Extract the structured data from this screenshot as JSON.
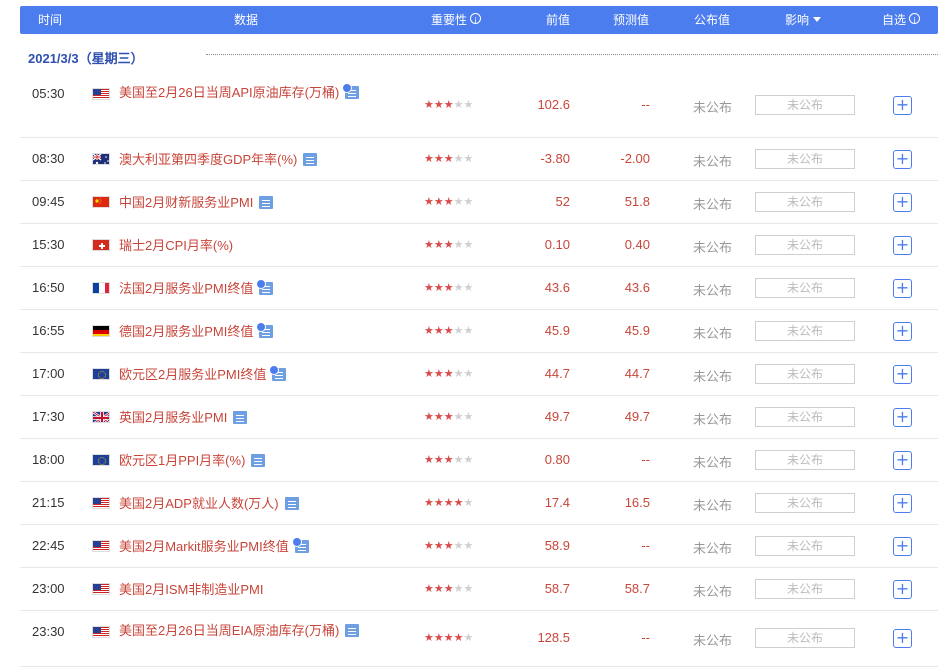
{
  "header": {
    "time": "时间",
    "data": "数据",
    "importance": "重要性",
    "info_glyph": "i",
    "previous": "前值",
    "forecast": "预测值",
    "actual": "公布值",
    "impact": "影响",
    "watchlist": "自选"
  },
  "date_label": "2021/3/3（星期三）",
  "rows": [
    {
      "time": "05:30",
      "flag": "us",
      "name": "美国至2月26日当周API原油库存(万桶)",
      "stars": 3,
      "prev": "102.6",
      "forecast": "--",
      "actual": "未公布",
      "impact": "未公布",
      "icon": "video-doc"
    },
    {
      "time": "08:30",
      "flag": "au",
      "name": "澳大利亚第四季度GDP年率(%)",
      "stars": 3,
      "prev": "-3.80",
      "forecast": "-2.00",
      "actual": "未公布",
      "impact": "未公布",
      "icon": "doc"
    },
    {
      "time": "09:45",
      "flag": "cn",
      "name": "中国2月财新服务业PMI",
      "stars": 3,
      "prev": "52",
      "forecast": "51.8",
      "actual": "未公布",
      "impact": "未公布",
      "icon": "doc"
    },
    {
      "time": "15:30",
      "flag": "ch",
      "name": "瑞士2月CPI月率(%)",
      "stars": 3,
      "prev": "0.10",
      "forecast": "0.40",
      "actual": "未公布",
      "impact": "未公布",
      "icon": "none"
    },
    {
      "time": "16:50",
      "flag": "fr",
      "name": "法国2月服务业PMI终值",
      "stars": 3,
      "prev": "43.6",
      "forecast": "43.6",
      "actual": "未公布",
      "impact": "未公布",
      "icon": "video-doc"
    },
    {
      "time": "16:55",
      "flag": "de",
      "name": "德国2月服务业PMI终值",
      "stars": 3,
      "prev": "45.9",
      "forecast": "45.9",
      "actual": "未公布",
      "impact": "未公布",
      "icon": "video-doc"
    },
    {
      "time": "17:00",
      "flag": "eu",
      "name": "欧元区2月服务业PMI终值",
      "stars": 3,
      "prev": "44.7",
      "forecast": "44.7",
      "actual": "未公布",
      "impact": "未公布",
      "icon": "video-doc"
    },
    {
      "time": "17:30",
      "flag": "uk",
      "name": "英国2月服务业PMI",
      "stars": 3,
      "prev": "49.7",
      "forecast": "49.7",
      "actual": "未公布",
      "impact": "未公布",
      "icon": "doc"
    },
    {
      "time": "18:00",
      "flag": "eu",
      "name": "欧元区1月PPI月率(%)",
      "stars": 3,
      "prev": "0.80",
      "forecast": "--",
      "actual": "未公布",
      "impact": "未公布",
      "icon": "doc"
    },
    {
      "time": "21:15",
      "flag": "us",
      "name": "美国2月ADP就业人数(万人)",
      "stars": 4,
      "prev": "17.4",
      "forecast": "16.5",
      "actual": "未公布",
      "impact": "未公布",
      "icon": "doc"
    },
    {
      "time": "22:45",
      "flag": "us",
      "name": "美国2月Markit服务业PMI终值",
      "stars": 3,
      "prev": "58.9",
      "forecast": "--",
      "actual": "未公布",
      "impact": "未公布",
      "icon": "video-doc"
    },
    {
      "time": "23:00",
      "flag": "us",
      "name": "美国2月ISM非制造业PMI",
      "stars": 3,
      "prev": "58.7",
      "forecast": "58.7",
      "actual": "未公布",
      "impact": "未公布",
      "icon": "none"
    },
    {
      "time": "23:30",
      "flag": "us",
      "name": "美国至2月26日当周EIA原油库存(万桶)",
      "stars": 4,
      "prev": "128.5",
      "forecast": "--",
      "actual": "未公布",
      "impact": "未公布",
      "icon": "doc"
    }
  ],
  "add_glyph": "+",
  "star_glyph": "★",
  "colors": {
    "header_bg": "#4b7dee",
    "date_text": "#2f4fb0",
    "event_text": "#c8453a",
    "star_active": "#d94b4b",
    "star_inactive": "#cfcfcf",
    "muted_text": "#999999"
  }
}
